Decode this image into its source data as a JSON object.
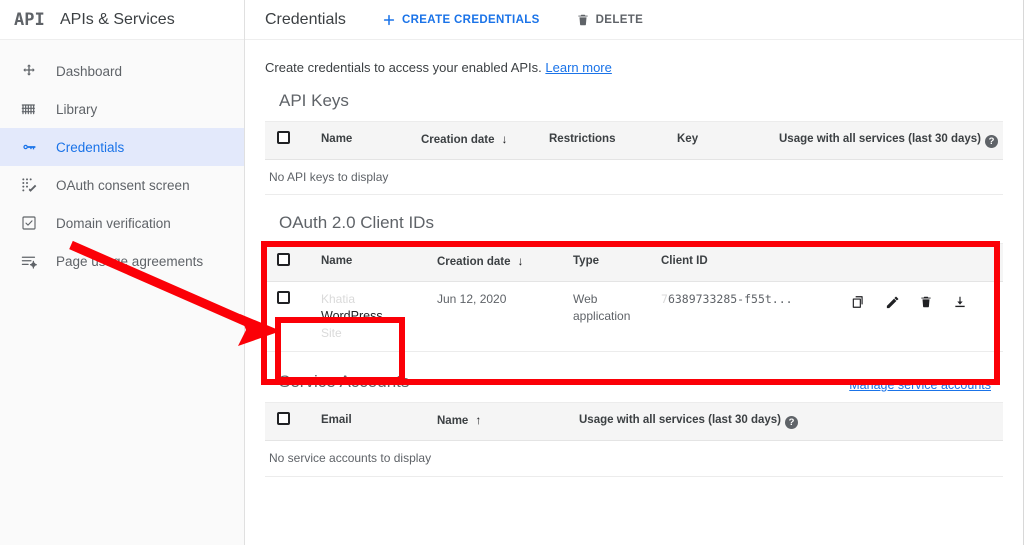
{
  "sidebar": {
    "logo_text": "API",
    "app_title": "APIs & Services",
    "items": [
      {
        "label": "Dashboard",
        "icon": "dashboard-icon",
        "active": false
      },
      {
        "label": "Library",
        "icon": "library-icon",
        "active": false
      },
      {
        "label": "Credentials",
        "icon": "key-icon",
        "active": true
      },
      {
        "label": "OAuth consent screen",
        "icon": "oauth-consent-icon",
        "active": false
      },
      {
        "label": "Domain verification",
        "icon": "domain-verification-icon",
        "active": false
      },
      {
        "label": "Page usage agreements",
        "icon": "page-usage-agreements-icon",
        "active": false
      }
    ]
  },
  "topbar": {
    "title": "Credentials",
    "create_label": "CREATE CREDENTIALS",
    "create_icon": "plus-icon",
    "delete_label": "DELETE",
    "delete_icon": "trash-icon"
  },
  "intro": {
    "text": "Create credentials to access your enabled APIs.",
    "link_label": "Learn more"
  },
  "api_keys": {
    "title": "API Keys",
    "columns": [
      "Name",
      "Creation date",
      "Restrictions",
      "Key",
      "Usage with all services (last 30 days)"
    ],
    "sort_column": "Creation date",
    "sort_direction": "down",
    "help_glyph": "?",
    "empty_text": "No API keys to display"
  },
  "oauth_clients": {
    "title": "OAuth 2.0 Client IDs",
    "columns": [
      "Name",
      "Creation date",
      "Type",
      "Client ID"
    ],
    "sort_column": "Creation date",
    "sort_direction": "down",
    "rows": [
      {
        "name_faded_top": "Khatia",
        "name": "WordPress",
        "name_faded_bottom": "Site",
        "creation_date": "Jun 12, 2020",
        "type": "Web application",
        "client_id_faded_prefix": "7",
        "client_id": "6389733285-f55t...",
        "actions": [
          "copy-icon",
          "edit-icon",
          "delete-icon",
          "download-icon"
        ]
      }
    ]
  },
  "service_accounts": {
    "title": "Service Accounts",
    "manage_link_label": "Manage service accounts",
    "columns": [
      "Email",
      "Name",
      "Usage with all services (last 30 days)"
    ],
    "sort_column": "Name",
    "sort_direction": "up",
    "help_glyph": "?",
    "empty_text": "No service accounts to display"
  },
  "annotations": {
    "highlight_color": "#fb0007",
    "boxes": [
      "oauth-section-highlight",
      "oauth-row-name-highlight"
    ],
    "arrow": "pointer-arrow-to-oauth-row"
  }
}
